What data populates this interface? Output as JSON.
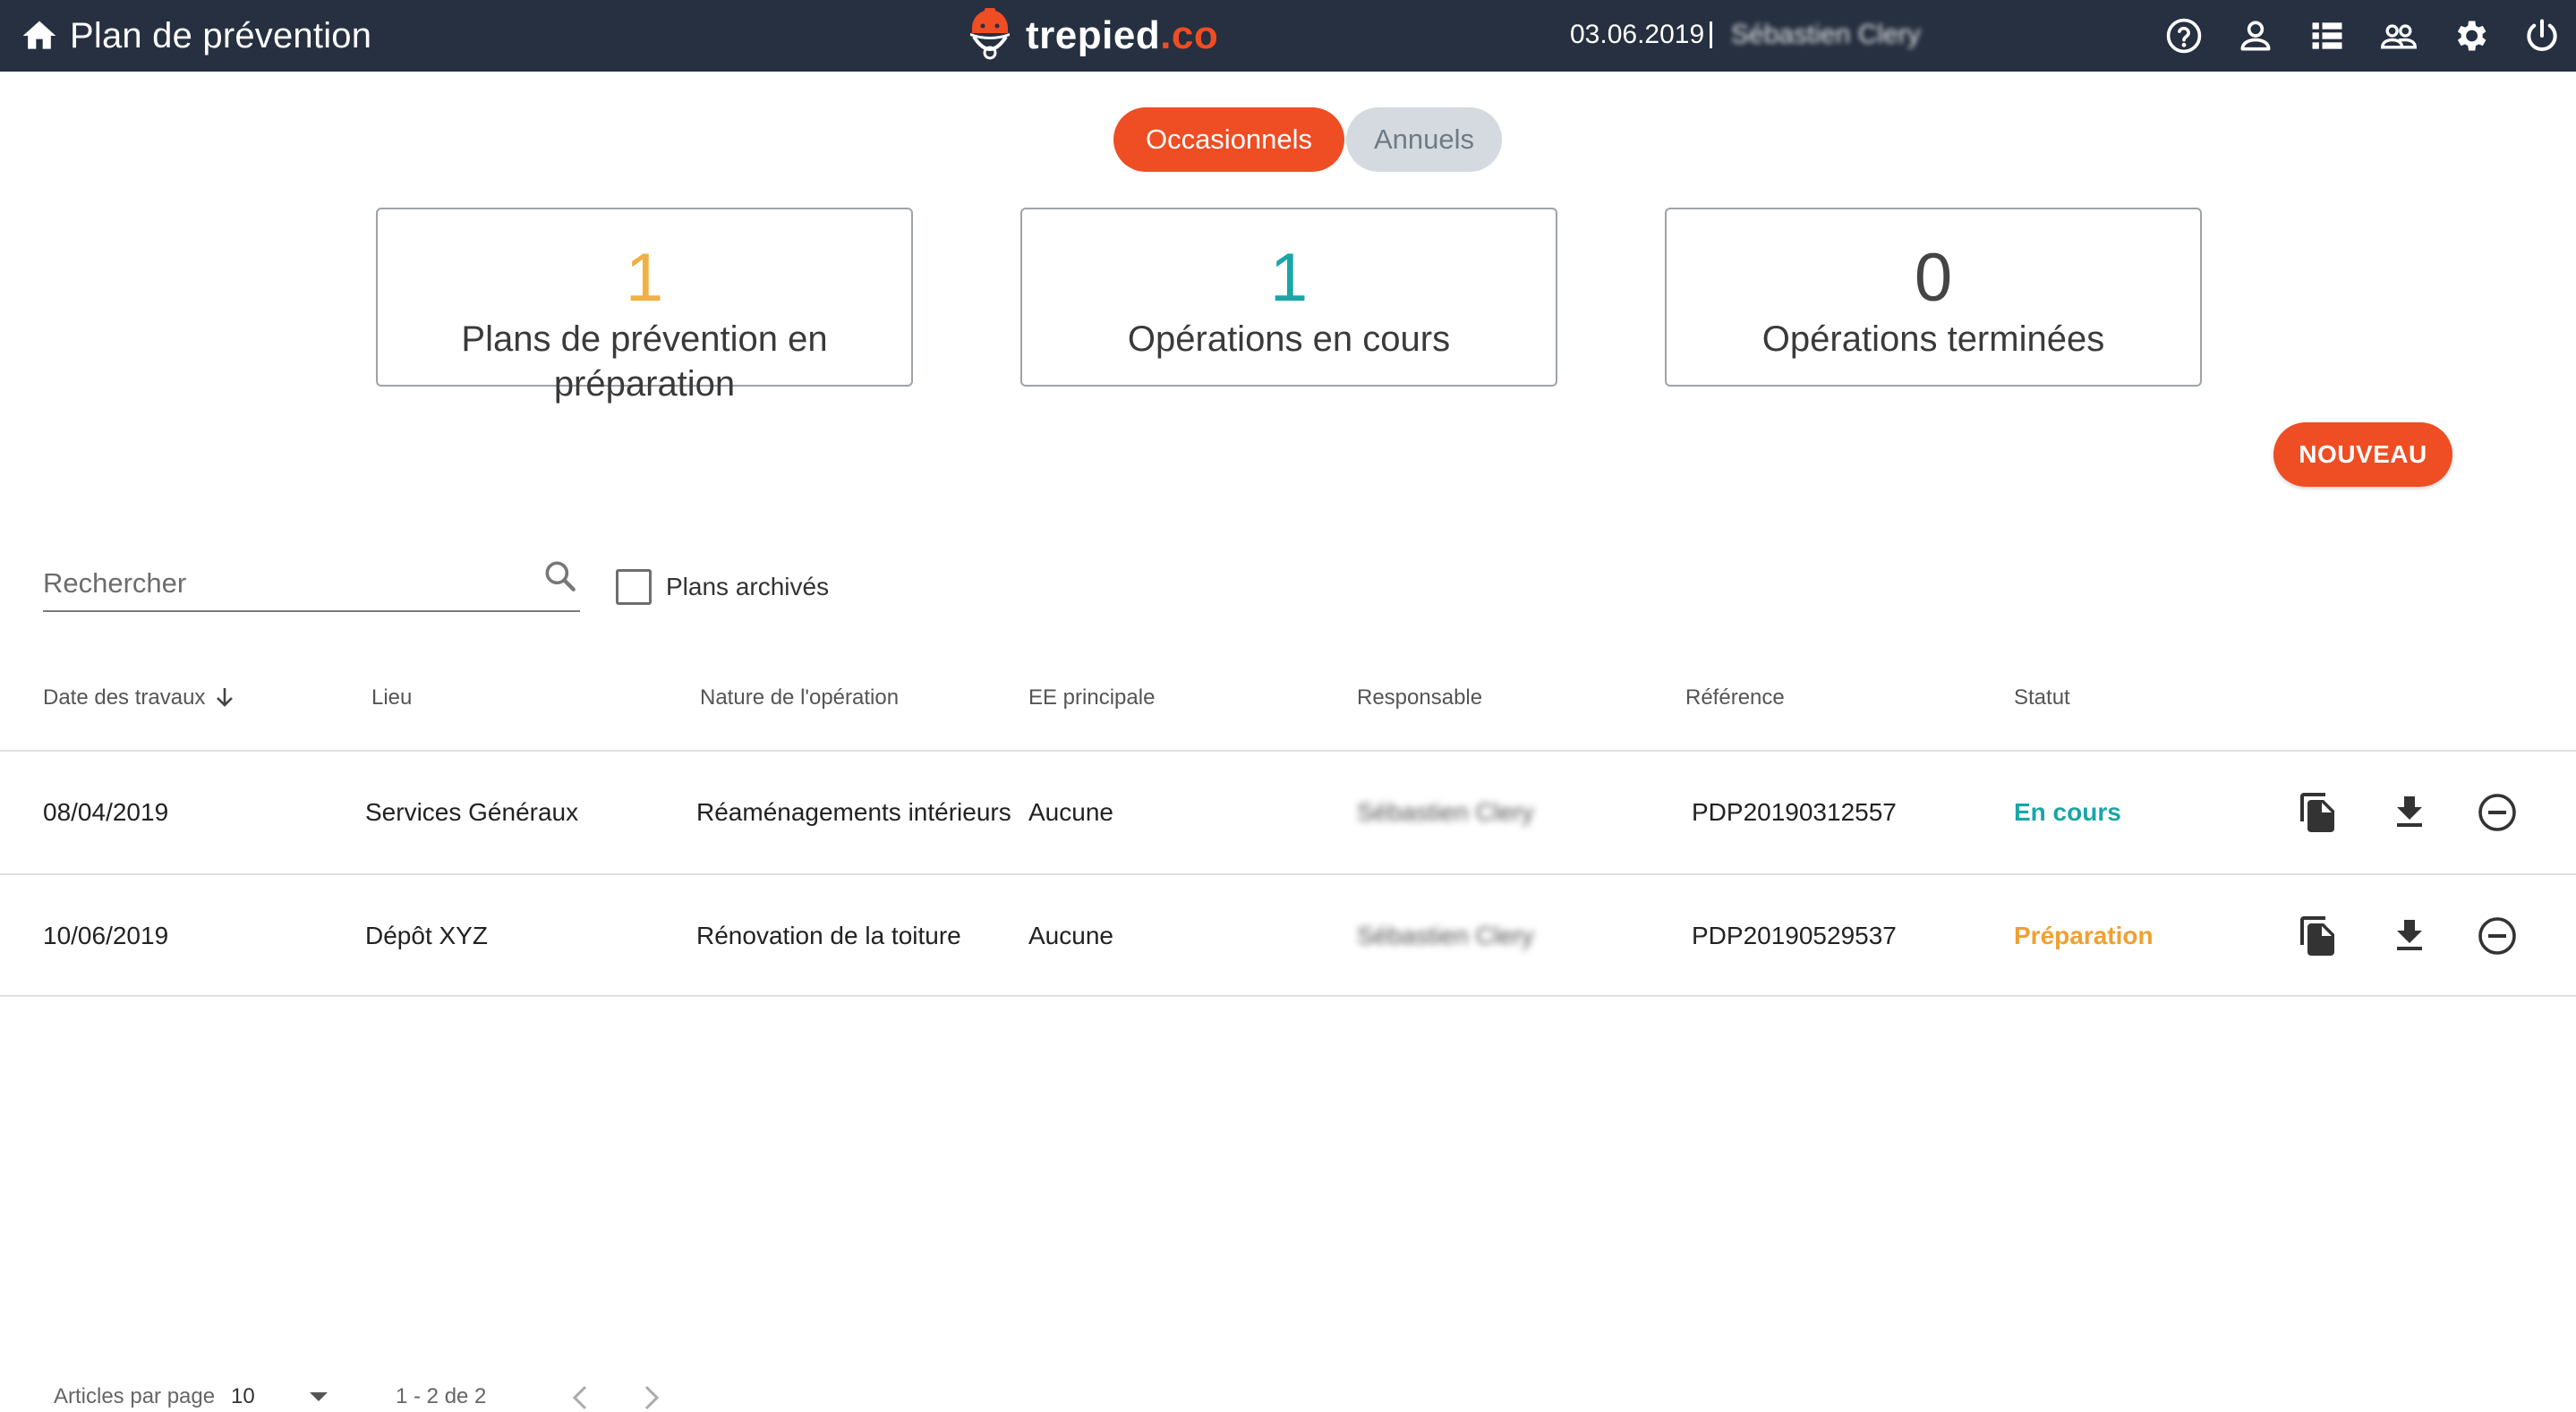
{
  "header": {
    "title": "Plan de prévention",
    "logo_text_main": "trepied",
    "logo_text_accent": ".co",
    "date": "03.06.2019",
    "user_name": "Sébastien Clery",
    "icons": [
      "help-icon",
      "user-icon",
      "list-icon",
      "group-icon",
      "gear-icon",
      "power-icon"
    ],
    "background_color": "#263040"
  },
  "tabs": [
    {
      "label": "Occasionnels",
      "active": true
    },
    {
      "label": "Annuels",
      "active": false
    }
  ],
  "stats": [
    {
      "value": "1",
      "label": "Plans de prévention en préparation",
      "color": "#f0b043"
    },
    {
      "value": "1",
      "label": "Opérations en cours",
      "color": "#1aa6a6"
    },
    {
      "value": "0",
      "label": "Opérations terminées",
      "color": "#444444"
    }
  ],
  "new_button_label": "NOUVEAU",
  "search": {
    "placeholder": "Rechercher",
    "value": ""
  },
  "archived_filter": {
    "label": "Plans archivés",
    "checked": false
  },
  "table": {
    "columns": [
      "Date des travaux",
      "Lieu",
      "Nature de l'opération",
      "EE principale",
      "Responsable",
      "Référence",
      "Statut"
    ],
    "sort_column": "Date des travaux",
    "sort_direction": "descending",
    "rows": [
      {
        "date": "08/04/2019",
        "lieu": "Services Généraux",
        "nature": "Réaménagements intérieurs",
        "ee": "Aucune",
        "responsable": "Sébastien Clery",
        "reference": "PDP20190312557",
        "statut": "En cours",
        "statut_color": "#1aa6a6"
      },
      {
        "date": "10/06/2019",
        "lieu": "Dépôt XYZ",
        "nature": "Rénovation de la toiture",
        "ee": "Aucune",
        "responsable": "Sébastien Clery",
        "reference": "PDP20190529537",
        "statut": "Préparation",
        "statut_color": "#f0a030"
      }
    ],
    "row_actions": [
      "copy-icon",
      "download-icon",
      "remove-circle-icon"
    ]
  },
  "pagination": {
    "per_page_label": "Articles par page",
    "per_page_value": "10",
    "range_text": "1 - 2 de 2"
  },
  "accent_color": "#ef4d23"
}
